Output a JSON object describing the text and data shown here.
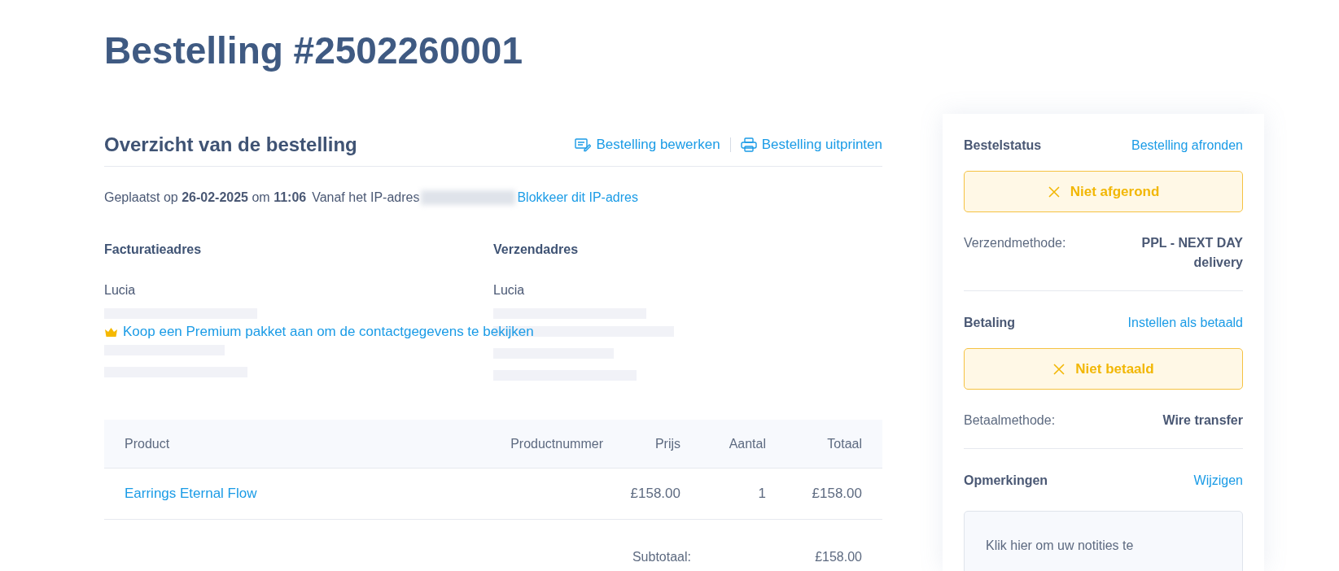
{
  "title": "Bestelling #2502260001",
  "overview": {
    "heading": "Overzicht van de bestelling",
    "actions": [
      {
        "kind": "edit",
        "label": "Bestelling bewerken"
      },
      {
        "kind": "print",
        "label": "Bestelling uitprinten"
      }
    ],
    "placed": "Geplaatst op **26-02-2025** om **11:06**",
    "ip_label": "Vanaf het IP-adres",
    "ip_redacted": true,
    "block_link": "Blokkeer dit IP-adres"
  },
  "addresses": [
    {
      "heading": "Facturatieadres",
      "name": "Lucia"
    },
    {
      "heading": "Verzendadres",
      "name": "Lucia"
    }
  ],
  "premium_link": "Koop een Premium pakket aan om de contactgegevens te bekijken",
  "table": {
    "columns": [
      "Product",
      "Productnummer",
      "Prijs",
      "Aantal",
      "Totaal"
    ],
    "rows": [
      {
        "product": "Earrings Eternal Flow",
        "number": "",
        "price": "£158.00",
        "qty": "1",
        "total": "£158.00"
      }
    ],
    "subtotal_label": "Subtotaal:",
    "subtotal": "£158.00"
  },
  "sidebar": [
    {
      "kind": "status",
      "heading": "Bestelstatus",
      "action": "Bestelling afronden",
      "badge": "Niet afgerond",
      "detail_label": "Verzendmethode:",
      "detail_value": "PPL - NEXT DAY delivery"
    },
    {
      "kind": "status",
      "heading": "Betaling",
      "action": "Instellen als betaald",
      "badge": "Niet betaald",
      "detail_label": "Betaalmethode:",
      "detail_value": "Wire transfer"
    },
    {
      "kind": "notes",
      "heading": "Opmerkingen",
      "action": "Wijzigen",
      "placeholder": "Klik hier om uw notities te"
    }
  ]
}
